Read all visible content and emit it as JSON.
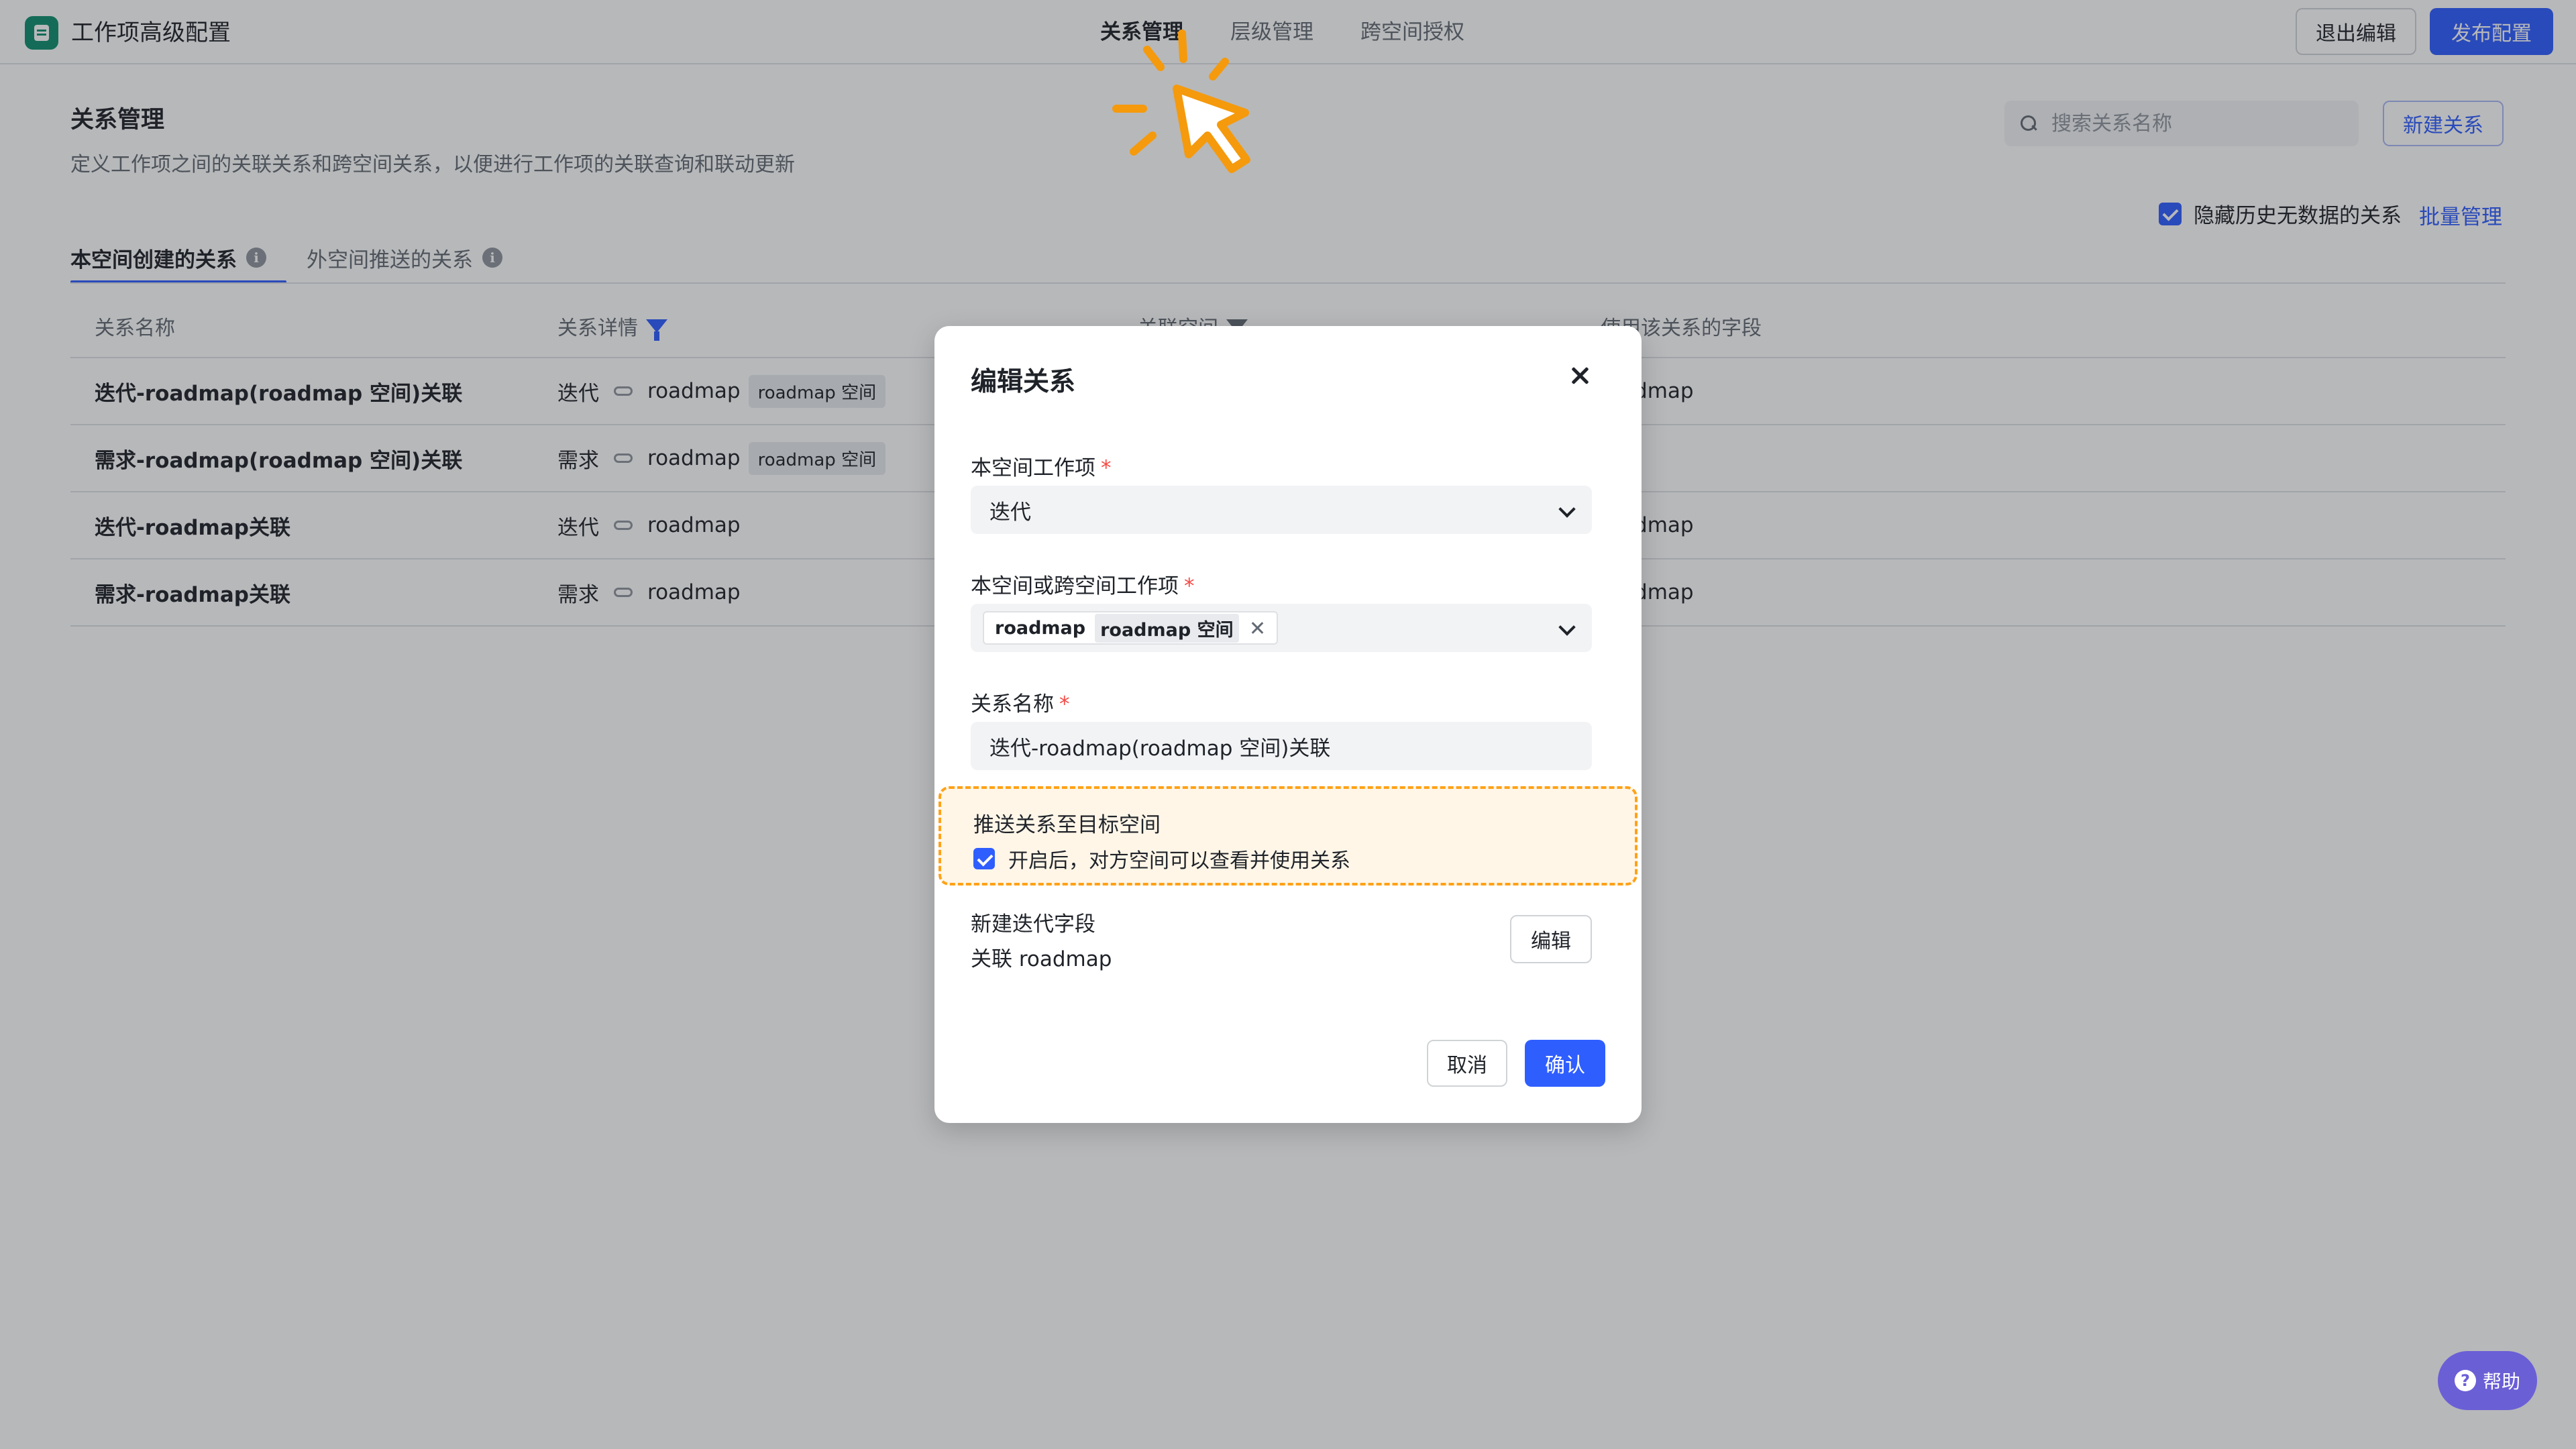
{
  "app": {
    "title": "工作项高级配置",
    "nav": [
      {
        "label": "关系管理",
        "active": true
      },
      {
        "label": "层级管理",
        "active": false
      },
      {
        "label": "跨空间授权",
        "active": false
      }
    ],
    "exit_label": "退出编辑",
    "publish_label": "发布配置"
  },
  "section": {
    "title": "关系管理",
    "description": "定义工作项之间的关联关系和跨空间关系，以便进行工作项的关联查询和联动更新",
    "search_placeholder": "搜索关系名称",
    "new_label": "新建关系",
    "hide_label": "隐藏历史无数据的关系",
    "hide_checked": true,
    "batch_label": "批量管理"
  },
  "tabs": [
    {
      "label": "本空间创建的关系",
      "active": true
    },
    {
      "label": "外空间推送的关系",
      "active": false
    }
  ],
  "table": {
    "headers": [
      "关系名称",
      "关系详情",
      "关联空间",
      "使用该关系的字段"
    ],
    "rows": [
      {
        "name": "迭代-roadmap(roadmap 空间)关联",
        "from": "迭代",
        "to": "roadmap",
        "tag": "roadmap 空间",
        "field": "roadmap"
      },
      {
        "name": "需求-roadmap(roadmap 空间)关联",
        "from": "需求",
        "to": "roadmap",
        "tag": "roadmap 空间",
        "field": ""
      },
      {
        "name": "迭代-roadmap关联",
        "from": "迭代",
        "to": "roadmap",
        "tag": "",
        "field": "roadmap"
      },
      {
        "name": "需求-roadmap关联",
        "from": "需求",
        "to": "roadmap",
        "tag": "",
        "field": "roadmap"
      }
    ]
  },
  "modal": {
    "title": "编辑关系",
    "field1_label": "本空间工作项",
    "field1_value": "迭代",
    "field2_label": "本空间或跨空间工作项",
    "field2_chip": "roadmap",
    "field2_chip_tag": "roadmap 空间",
    "field3_label": "关系名称",
    "field3_value": "迭代-roadmap(roadmap 空间)关联",
    "required_mark": "*",
    "push_title": "推送关系至目标空间",
    "push_desc": "开启后，对方空间可以查看并使用关系",
    "push_checked": true,
    "newfield_title": "新建迭代字段",
    "newfield_sub": "关联 roadmap",
    "edit_label": "编辑",
    "cancel_label": "取消",
    "confirm_label": "确认"
  },
  "help_label": "帮助",
  "colors": {
    "accent": "#2f5eff",
    "highlight_border": "#ffa116",
    "highlight_bg": "#fff6e8",
    "required": "#f54a45",
    "logo": "#0f8f6f",
    "help": "#6b5fd6"
  }
}
